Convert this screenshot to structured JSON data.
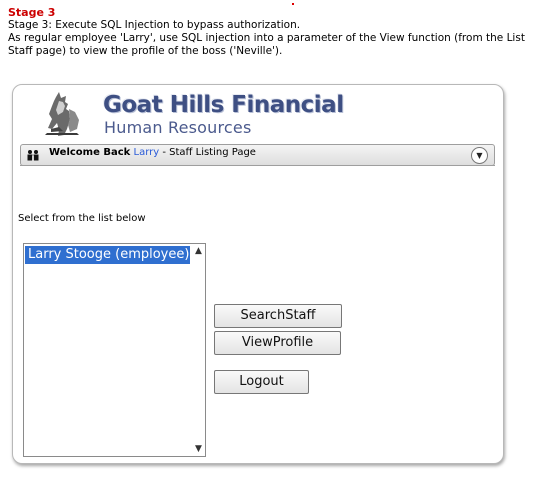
{
  "stage": {
    "title": "Stage 3",
    "description_line1": "Stage 3: Execute SQL Injection to bypass authorization.",
    "description_line2": "As regular employee 'Larry', use SQL injection into a parameter of the View function (from the List Staff page) to view the profile of the boss ('Neville')."
  },
  "header": {
    "company_name": "Goat Hills Financial",
    "department": "Human Resources",
    "logo_icon": "goat-logo-icon"
  },
  "welcome_bar": {
    "prefix": "Welcome Back",
    "user": "Larry",
    "suffix": "- Staff Listing Page",
    "users_icon": "users-icon",
    "collapse_icon": "chevron-down-icon"
  },
  "staff_list": {
    "label": "Select from the list below",
    "items": [
      {
        "label": "Larry Stooge (employee)",
        "selected": true
      }
    ]
  },
  "buttons": {
    "search": "SearchStaff",
    "view": "ViewProfile",
    "logout": "Logout"
  },
  "colors": {
    "stage_title": "#cc0000",
    "brand": "#3e4f83",
    "selection": "#2f6fd0",
    "user_link": "#2a5bd7"
  }
}
